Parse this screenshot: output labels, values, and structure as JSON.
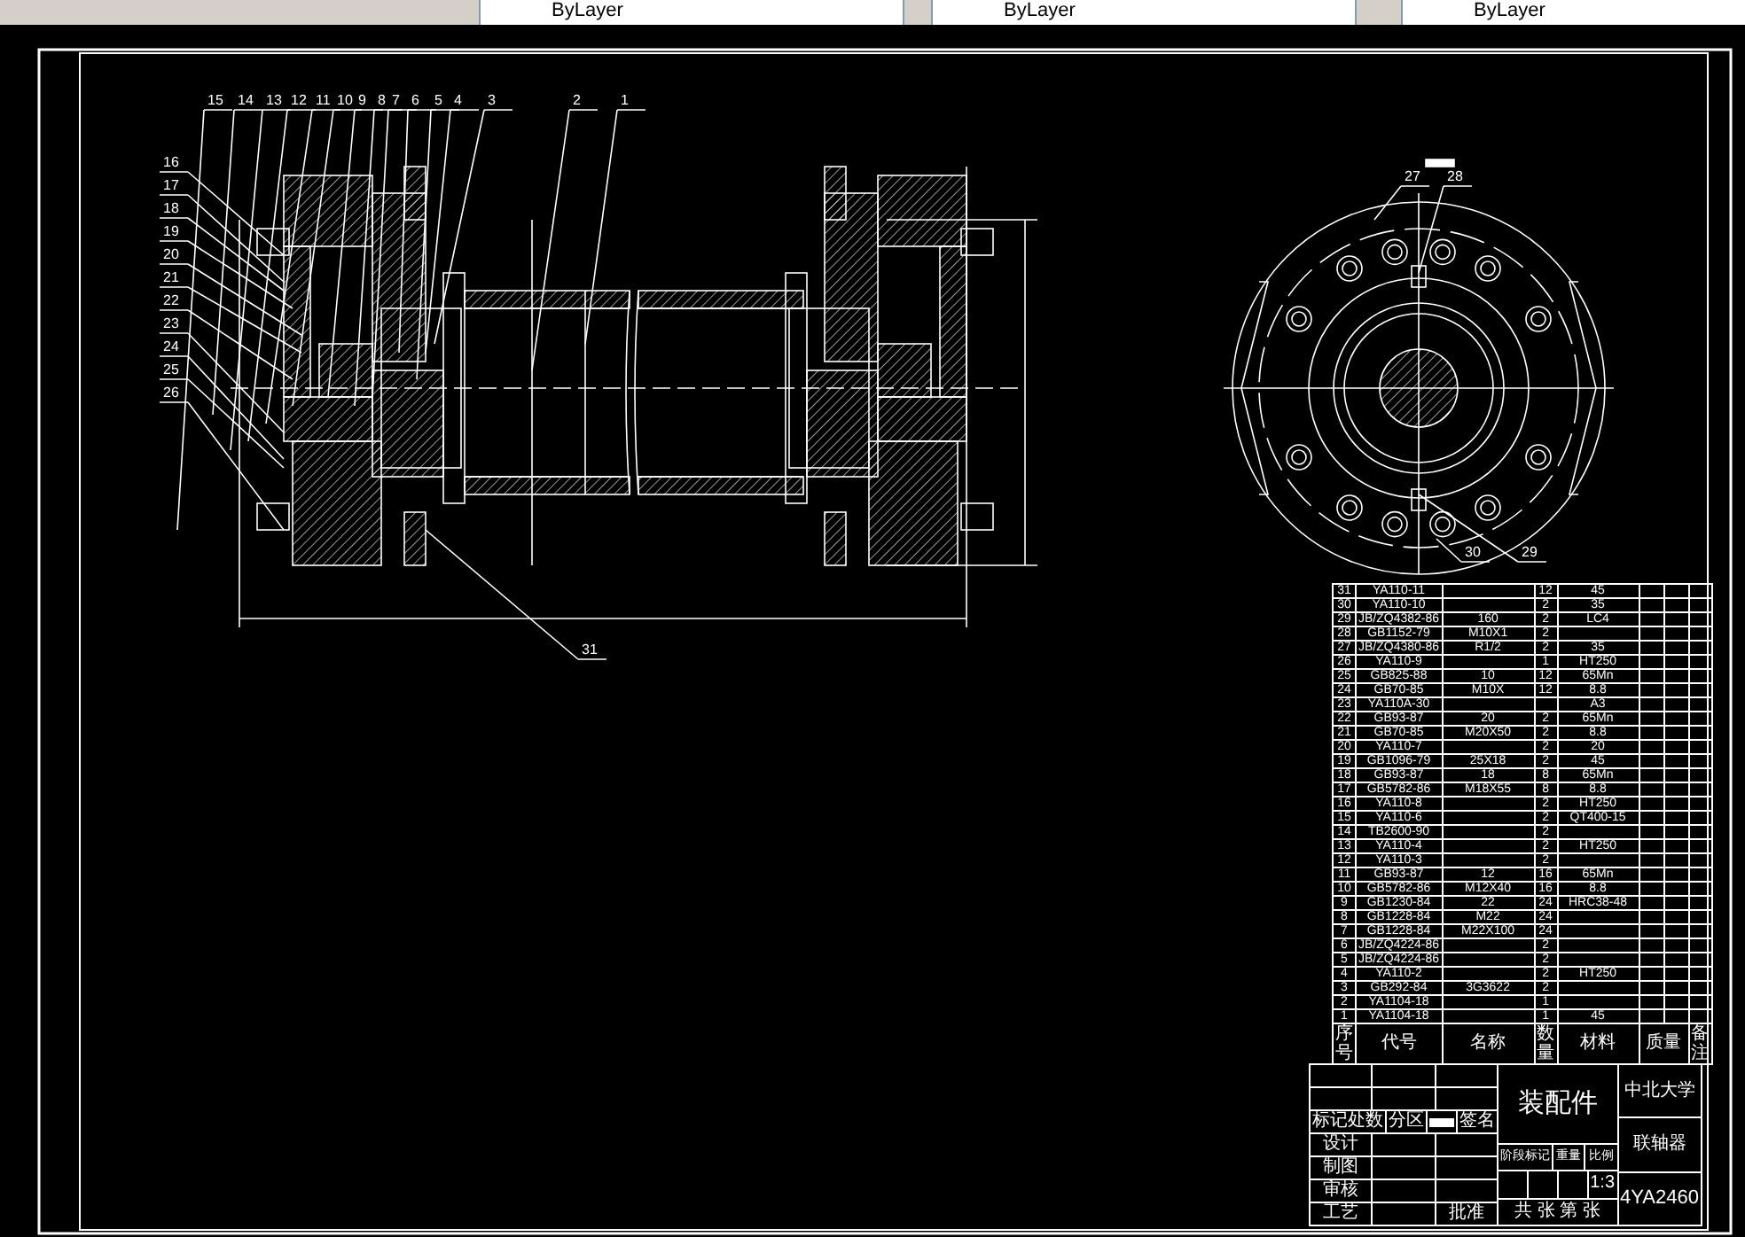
{
  "toolbar": {
    "dropdowns": [
      {
        "value": "ByLayer"
      },
      {
        "value": "ByLayer"
      },
      {
        "value": "ByLayer"
      }
    ]
  },
  "callouts": [
    {
      "label": "15"
    },
    {
      "label": "14"
    },
    {
      "label": "13"
    },
    {
      "label": "12"
    },
    {
      "label": "11"
    },
    {
      "label": "10"
    },
    {
      "label": "9"
    },
    {
      "label": "8"
    },
    {
      "label": "7"
    },
    {
      "label": "6"
    },
    {
      "label": "5"
    },
    {
      "label": "4"
    },
    {
      "label": "3"
    },
    {
      "label": "2"
    },
    {
      "label": "1"
    },
    {
      "label": "16"
    },
    {
      "label": "17"
    },
    {
      "label": "18"
    },
    {
      "label": "19"
    },
    {
      "label": "20"
    },
    {
      "label": "21"
    },
    {
      "label": "22"
    },
    {
      "label": "23"
    },
    {
      "label": "24"
    },
    {
      "label": "25"
    },
    {
      "label": "26"
    },
    {
      "label": "31"
    },
    {
      "label": "27"
    },
    {
      "label": "28"
    },
    {
      "label": "30"
    },
    {
      "label": "29"
    }
  ],
  "parts_table": {
    "header": {
      "no": "序号",
      "code": "代号",
      "name": "名称",
      "qty": "数量",
      "material": "材料",
      "weight": "质量",
      "note": "备注"
    },
    "rows": [
      {
        "no": "31",
        "code": "YA110-11",
        "qty": "12",
        "material": "45"
      },
      {
        "no": "30",
        "code": "YA110-10",
        "qty": "2",
        "material": "35"
      },
      {
        "no": "29",
        "code": "JB/ZQ4382-86",
        "name": "160",
        "qty": "2",
        "material": "LC4"
      },
      {
        "no": "28",
        "code": "GB1152-79",
        "name": "M10X1",
        "qty": "2"
      },
      {
        "no": "27",
        "code": "JB/ZQ4380-86",
        "name": "R1/2",
        "qty": "2",
        "material": "35"
      },
      {
        "no": "26",
        "code": "YA110-9",
        "qty": "1",
        "material": "HT250"
      },
      {
        "no": "25",
        "code": "GB825-88",
        "name": "10",
        "qty": "12",
        "material": "65Mn"
      },
      {
        "no": "24",
        "code": "GB70-85",
        "name": "M10X",
        "qty": "12",
        "material": "8.8"
      },
      {
        "no": "23",
        "code": "YA110A-30",
        "material": "A3"
      },
      {
        "no": "22",
        "code": "GB93-87",
        "name": "20",
        "qty": "2",
        "material": "65Mn"
      },
      {
        "no": "21",
        "code": "GB70-85",
        "name": "M20X50",
        "qty": "2",
        "material": "8.8"
      },
      {
        "no": "20",
        "code": "YA110-7",
        "qty": "2",
        "material": "20"
      },
      {
        "no": "19",
        "code": "GB1096-79",
        "name": "25X18",
        "qty": "2",
        "material": "45"
      },
      {
        "no": "18",
        "code": "GB93-87",
        "name": "18",
        "qty": "8",
        "material": "65Mn"
      },
      {
        "no": "17",
        "code": "GB5782-86",
        "name": "M18X55",
        "qty": "8",
        "material": "8.8"
      },
      {
        "no": "16",
        "code": "YA110-8",
        "qty": "2",
        "material": "HT250"
      },
      {
        "no": "15",
        "code": "YA110-6",
        "qty": "2",
        "material": "QT400-15"
      },
      {
        "no": "14",
        "code": "TB2600-90",
        "qty": "2"
      },
      {
        "no": "13",
        "code": "YA110-4",
        "qty": "2",
        "material": "HT250"
      },
      {
        "no": "12",
        "code": "YA110-3",
        "qty": "2"
      },
      {
        "no": "11",
        "code": "GB93-87",
        "name": "12",
        "qty": "16",
        "material": "65Mn"
      },
      {
        "no": "10",
        "code": "GB5782-86",
        "name": "M12X40",
        "qty": "16",
        "material": "8.8"
      },
      {
        "no": "9",
        "code": "GB1230-84",
        "name": "22",
        "qty": "24",
        "material": "HRC38-48"
      },
      {
        "no": "8",
        "code": "GB1228-84",
        "name": "M22",
        "qty": "24"
      },
      {
        "no": "7",
        "code": "GB1228-84",
        "name": "M22X100",
        "qty": "24"
      },
      {
        "no": "6",
        "code": "JB/ZQ4224-86",
        "qty": "2"
      },
      {
        "no": "5",
        "code": "JB/ZQ4224-86",
        "qty": "2"
      },
      {
        "no": "4",
        "code": "YA110-2",
        "qty": "2",
        "material": "HT250"
      },
      {
        "no": "3",
        "code": "GB292-84",
        "name": "3G3622",
        "qty": "2"
      },
      {
        "no": "2",
        "code": "YA1104-18",
        "qty": "1"
      },
      {
        "no": "1",
        "code": "YA1104-18",
        "qty": "1",
        "material": "45"
      }
    ]
  },
  "title_block": {
    "revision_labels": [
      "标记处数",
      "分区",
      "签名"
    ],
    "role_labels": [
      "设计",
      "制图",
      "审核",
      "工艺"
    ],
    "approve_label": "批准",
    "drawing_type": "装配件",
    "stage_labels": [
      "阶段标记",
      "重量",
      "比例"
    ],
    "scale": "1:3",
    "sheet_label": "共 张 第 张",
    "school": "中北大学",
    "part_name": "联轴器",
    "drawing_number": "4YA2460"
  }
}
